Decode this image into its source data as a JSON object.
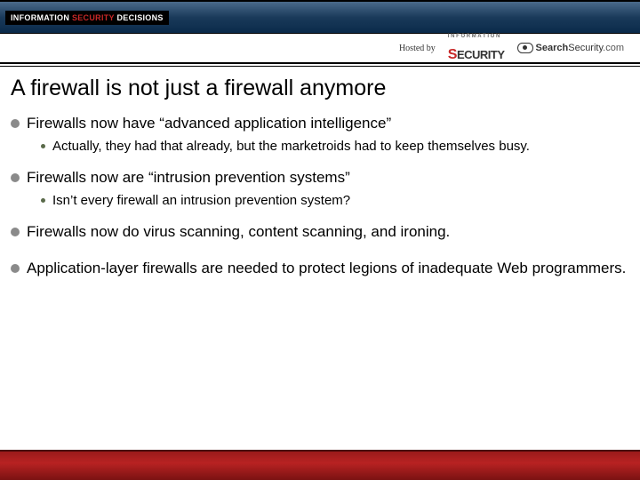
{
  "header": {
    "brand_prefix": "INFORMATION ",
    "brand_mid": "SECURITY",
    "brand_suffix": " DECISIONS",
    "hosted_by": "Hosted by",
    "sponsor1_sup": "I N F O R M A T I O N",
    "sponsor1_s": "S",
    "sponsor1_rest": "ECURITY",
    "sponsor2_bold": "Search",
    "sponsor2_rest": "Security",
    "sponsor2_dom": ".com"
  },
  "title": "A firewall is not just a firewall anymore",
  "bullets": [
    {
      "text": "Firewalls now have “advanced application intelligence”",
      "sub": "Actually, they had that already, but the marketroids had to keep themselves busy."
    },
    {
      "text": "Firewalls now are “intrusion prevention systems”",
      "sub": "Isn’t every firewall an intrusion prevention system?"
    },
    {
      "text": "Firewalls now do virus scanning, content scanning, and ironing.",
      "sub": null
    },
    {
      "text": "Application-layer firewalls are needed to protect legions of inadequate Web programmers.",
      "sub": null
    }
  ]
}
